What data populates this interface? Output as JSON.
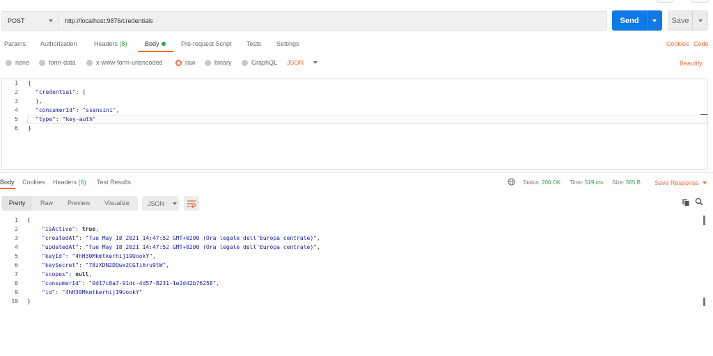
{
  "colors": {
    "accent": "#f26b3a",
    "primary": "#0f7ae5",
    "success": "#2aa44f"
  },
  "request": {
    "method": "POST",
    "url": "http://localhost:9876/credentials",
    "send_label": "Send",
    "save_label": "Save"
  },
  "request_tabs": {
    "params": "Params",
    "authorization": "Authorization",
    "headers": "Headers",
    "headers_count": "(8)",
    "body": "Body",
    "pre_request": "Pre-request Script",
    "tests": "Tests",
    "settings": "Settings",
    "cookies": "Cookies",
    "code": "Code"
  },
  "body_types": {
    "none": "none",
    "form_data": "form-data",
    "urlencoded": "x-www-form-urlencoded",
    "raw": "raw",
    "binary": "binary",
    "graphql": "GraphQL",
    "format": "JSON",
    "beautify": "Beautify"
  },
  "request_body": {
    "line_numbers": [
      "1",
      "2",
      "3",
      "4",
      "5",
      "6"
    ],
    "l1": "{",
    "l2_key": "\"credential\"",
    "l2_rest": ": {",
    "l3": "},",
    "l4_key": "\"consumerId\"",
    "l4_sep": ": ",
    "l4_val": "\"ssensini\"",
    "l4_end": ",",
    "l5_key": "\"type\"",
    "l5_sep": ": ",
    "l5_val": "\"key-auth\"",
    "l6": "}"
  },
  "response_tabs": {
    "body": "Body",
    "cookies": "Cookies",
    "headers": "Headers",
    "headers_count": "(6)",
    "test_results": "Test Results"
  },
  "response_meta": {
    "status_label": "Status:",
    "status_value": "200 OK",
    "time_label": "Time:",
    "time_value": "519 ms",
    "size_label": "Size:",
    "size_value": "565 B",
    "save_response": "Save Response"
  },
  "response_view": {
    "pretty": "Pretty",
    "raw": "Raw",
    "preview": "Preview",
    "visualize": "Visualize",
    "format": "JSON"
  },
  "response_body": {
    "line_numbers": [
      "1",
      "2",
      "3",
      "4",
      "5",
      "6",
      "7",
      "8",
      "9",
      "10"
    ],
    "l1": "{",
    "l2_key": "\"isActive\"",
    "l2_val": "true",
    "l3_key": "\"createdAt\"",
    "l3_val": "\"Tue May 18 2021 14:47:52 GMT+0200 (Ora legale dell’Europa centrale)\"",
    "l4_key": "\"updatedAt\"",
    "l4_val": "\"Tue May 18 2021 14:47:52 GMT+0200 (Ora legale dell’Europa centrale)\"",
    "l5_key": "\"keyId\"",
    "l5_val": "\"4hH30Mkmtkerhij19UookY\"",
    "l6_key": "\"keySecret\"",
    "l6_val": "\"78zXDN2DQwx2CGTi6ru9tW\"",
    "l7_key": "\"scopes\"",
    "l7_val": "null",
    "l8_key": "\"consumerId\"",
    "l8_val": "\"0d17c8a7-91dc-4d57-8231-1e2dd2b76258\"",
    "l9_key": "\"id\"",
    "l9_val": "\"4hH30Mkmtkerhij19UookY\"",
    "l10": "}"
  }
}
